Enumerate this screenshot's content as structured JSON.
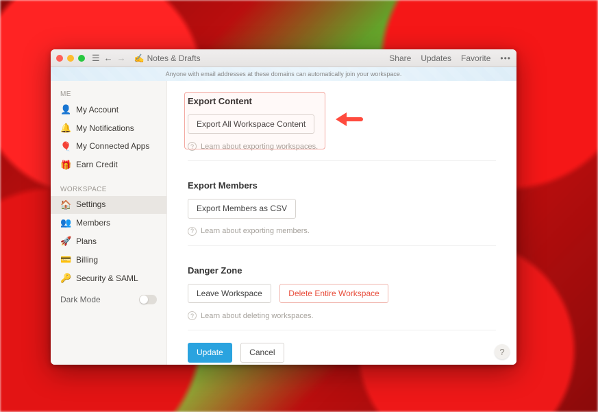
{
  "titlebar": {
    "doc_icon": "✍️",
    "doc_title": "Notes & Drafts",
    "right": {
      "share": "Share",
      "updates": "Updates",
      "favorite": "Favorite",
      "more": "•••"
    }
  },
  "banner": {
    "text": "Anyone with email addresses at these domains can automatically join your workspace."
  },
  "sidebar": {
    "labels": {
      "me": "ME",
      "workspace": "WORKSPACE"
    },
    "me_items": [
      {
        "icon": "👤",
        "label": "My Account"
      },
      {
        "icon": "🔔",
        "label": "My Notifications"
      },
      {
        "icon": "🎈",
        "label": "My Connected Apps"
      },
      {
        "icon": "🎁",
        "label": "Earn Credit"
      }
    ],
    "ws_items": [
      {
        "icon": "🏠",
        "label": "Settings",
        "active": true
      },
      {
        "icon": "👥",
        "label": "Members"
      },
      {
        "icon": "🚀",
        "label": "Plans"
      },
      {
        "icon": "💳",
        "label": "Billing"
      },
      {
        "icon": "🔑",
        "label": "Security & SAML"
      }
    ],
    "dark_mode": "Dark Mode"
  },
  "sections": {
    "export_content": {
      "title": "Export Content",
      "button": "Export All Workspace Content",
      "help": "Learn about exporting workspaces."
    },
    "export_members": {
      "title": "Export Members",
      "button": "Export Members as CSV",
      "help": "Learn about exporting members."
    },
    "danger": {
      "title": "Danger Zone",
      "leave": "Leave Workspace",
      "delete": "Delete Entire Workspace",
      "help": "Learn about deleting workspaces."
    }
  },
  "footer": {
    "update": "Update",
    "cancel": "Cancel"
  },
  "helpfab": "?"
}
